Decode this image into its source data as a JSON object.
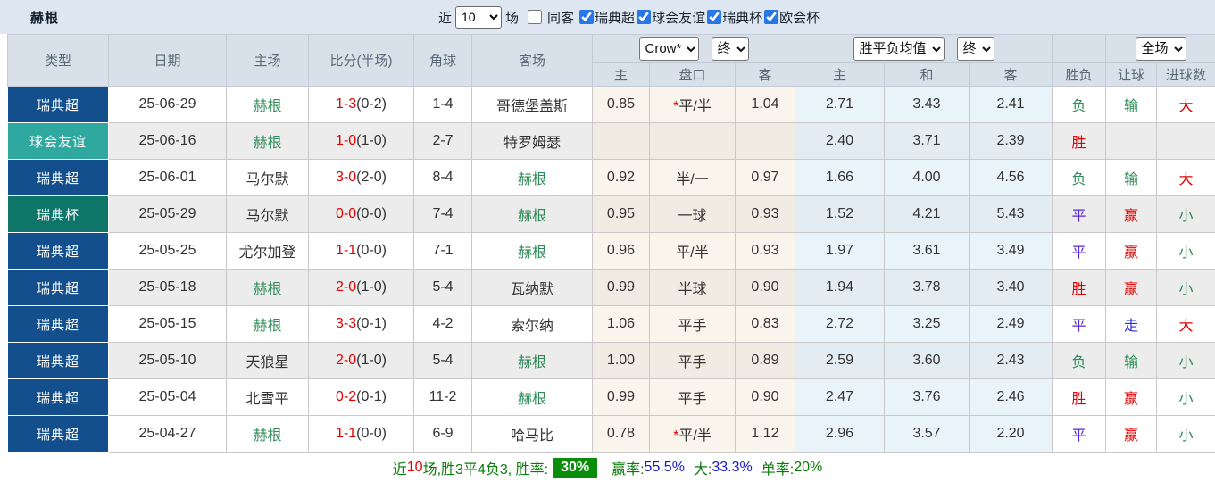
{
  "topbar": {
    "team": "赫根",
    "recent_label": "近",
    "recent_value": "10",
    "games_label": "场",
    "same_opponent": {
      "label": "同客",
      "checked": false
    },
    "filters": [
      {
        "label": "瑞典超",
        "checked": true
      },
      {
        "label": "球会友谊",
        "checked": true
      },
      {
        "label": "瑞典杯",
        "checked": true
      },
      {
        "label": "欧会杯",
        "checked": true
      }
    ]
  },
  "table": {
    "columns": [
      "类型",
      "日期",
      "主场",
      "比分(半场)",
      "角球",
      "客场"
    ],
    "odds_group": {
      "bookmaker": "Crow*",
      "time": "终",
      "subcols": [
        "主",
        "盘口",
        "客"
      ]
    },
    "avg_group": {
      "selector": "胜平负均值",
      "time": "终",
      "subcols": [
        "主",
        "和",
        "客"
      ]
    },
    "result_group": {
      "scope": "全场",
      "subcols": [
        "胜负",
        "让球",
        "进球数"
      ]
    },
    "rows": [
      {
        "type": "瑞典超",
        "type_color": "#134f8c",
        "date": "25-06-29",
        "home": "赫根",
        "home_hl": true,
        "score": "1-3",
        "half": "(0-2)",
        "corners": "1-4",
        "away": "哥德堡盖斯",
        "away_hl": false,
        "odds_home": "0.85",
        "handicap_star": true,
        "handicap": "平/半",
        "odds_away": "1.04",
        "avg_home": "2.71",
        "avg_draw": "3.43",
        "avg_away": "2.41",
        "result": "负",
        "result_color": "green",
        "let": "输",
        "let_color": "green",
        "goals": "大",
        "goals_color": "red",
        "shade": "light"
      },
      {
        "type": "球会友谊",
        "type_color": "#2fa89f",
        "date": "25-06-16",
        "home": "赫根",
        "home_hl": true,
        "score": "1-0",
        "half": "(1-0)",
        "corners": "2-7",
        "away": "特罗姆瑟",
        "away_hl": false,
        "odds_home": "",
        "handicap_star": false,
        "handicap": "",
        "odds_away": "",
        "avg_home": "2.40",
        "avg_draw": "3.71",
        "avg_away": "2.39",
        "result": "胜",
        "result_color": "red",
        "let": "",
        "let_color": "green",
        "goals": "",
        "goals_color": "green",
        "shade": "dark"
      },
      {
        "type": "瑞典超",
        "type_color": "#134f8c",
        "date": "25-06-01",
        "home": "马尔默",
        "home_hl": false,
        "score": "3-0",
        "half": "(2-0)",
        "corners": "8-4",
        "away": "赫根",
        "away_hl": true,
        "odds_home": "0.92",
        "handicap_star": false,
        "handicap": "半/一",
        "odds_away": "0.97",
        "avg_home": "1.66",
        "avg_draw": "4.00",
        "avg_away": "4.56",
        "result": "负",
        "result_color": "green",
        "let": "输",
        "let_color": "green",
        "goals": "大",
        "goals_color": "red",
        "shade": "light"
      },
      {
        "type": "瑞典杯",
        "type_color": "#0e7569",
        "date": "25-05-29",
        "home": "马尔默",
        "home_hl": false,
        "score": "0-0",
        "half": "(0-0)",
        "corners": "7-4",
        "away": "赫根",
        "away_hl": true,
        "odds_home": "0.95",
        "handicap_star": false,
        "handicap": "一球",
        "odds_away": "0.93",
        "avg_home": "1.52",
        "avg_draw": "4.21",
        "avg_away": "5.43",
        "result": "平",
        "result_color": "violet",
        "let": "赢",
        "let_color": "red",
        "goals": "小",
        "goals_color": "green",
        "shade": "dark"
      },
      {
        "type": "瑞典超",
        "type_color": "#134f8c",
        "date": "25-05-25",
        "home": "尤尔加登",
        "home_hl": false,
        "score": "1-1",
        "half": "(0-0)",
        "corners": "7-1",
        "away": "赫根",
        "away_hl": true,
        "odds_home": "0.96",
        "handicap_star": false,
        "handicap": "平/半",
        "odds_away": "0.93",
        "avg_home": "1.97",
        "avg_draw": "3.61",
        "avg_away": "3.49",
        "result": "平",
        "result_color": "violet",
        "let": "赢",
        "let_color": "red",
        "goals": "小",
        "goals_color": "green",
        "shade": "light"
      },
      {
        "type": "瑞典超",
        "type_color": "#134f8c",
        "date": "25-05-18",
        "home": "赫根",
        "home_hl": true,
        "score": "2-0",
        "half": "(1-0)",
        "corners": "5-4",
        "away": "瓦纳默",
        "away_hl": false,
        "odds_home": "0.99",
        "handicap_star": false,
        "handicap": "半球",
        "odds_away": "0.90",
        "avg_home": "1.94",
        "avg_draw": "3.78",
        "avg_away": "3.40",
        "result": "胜",
        "result_color": "red",
        "let": "赢",
        "let_color": "red",
        "goals": "小",
        "goals_color": "green",
        "shade": "dark"
      },
      {
        "type": "瑞典超",
        "type_color": "#134f8c",
        "date": "25-05-15",
        "home": "赫根",
        "home_hl": true,
        "score": "3-3",
        "half": "(0-1)",
        "corners": "4-2",
        "away": "索尔纳",
        "away_hl": false,
        "odds_home": "1.06",
        "handicap_star": false,
        "handicap": "平手",
        "odds_away": "0.83",
        "avg_home": "2.72",
        "avg_draw": "3.25",
        "avg_away": "2.49",
        "result": "平",
        "result_color": "violet",
        "let": "走",
        "let_color": "blue",
        "goals": "大",
        "goals_color": "red",
        "shade": "light"
      },
      {
        "type": "瑞典超",
        "type_color": "#134f8c",
        "date": "25-05-10",
        "home": "天狼星",
        "home_hl": false,
        "score": "2-0",
        "half": "(1-0)",
        "corners": "5-4",
        "away": "赫根",
        "away_hl": true,
        "odds_home": "1.00",
        "handicap_star": false,
        "handicap": "平手",
        "odds_away": "0.89",
        "avg_home": "2.59",
        "avg_draw": "3.60",
        "avg_away": "2.43",
        "result": "负",
        "result_color": "green",
        "let": "输",
        "let_color": "green",
        "goals": "小",
        "goals_color": "green",
        "shade": "dark"
      },
      {
        "type": "瑞典超",
        "type_color": "#134f8c",
        "date": "25-05-04",
        "home": "北雪平",
        "home_hl": false,
        "score": "0-2",
        "half": "(0-1)",
        "corners": "11-2",
        "away": "赫根",
        "away_hl": true,
        "odds_home": "0.99",
        "handicap_star": false,
        "handicap": "平手",
        "odds_away": "0.90",
        "avg_home": "2.47",
        "avg_draw": "3.76",
        "avg_away": "2.46",
        "result": "胜",
        "result_color": "red",
        "let": "赢",
        "let_color": "red",
        "goals": "小",
        "goals_color": "green",
        "shade": "light"
      },
      {
        "type": "瑞典超",
        "type_color": "#134f8c",
        "date": "25-04-27",
        "home": "赫根",
        "home_hl": true,
        "score": "1-1",
        "half": "(0-0)",
        "corners": "6-9",
        "away": "哈马比",
        "away_hl": false,
        "odds_home": "0.78",
        "handicap_star": true,
        "handicap": "平/半",
        "odds_away": "1.12",
        "avg_home": "2.96",
        "avg_draw": "3.57",
        "avg_away": "2.20",
        "result": "平",
        "result_color": "violet",
        "let": "赢",
        "let_color": "red",
        "goals": "小",
        "goals_color": "green",
        "shade": "light"
      }
    ]
  },
  "summary": {
    "prefix": "近",
    "count": "10",
    "mid": "场,胜3平4负3, 胜率:",
    "win_rate": "30%",
    "label_win": "赢率:",
    "value_win": "55.5%",
    "label_big": "大:",
    "value_big": "33.3%",
    "label_single": "单率:",
    "value_single": "20%"
  },
  "colors": {
    "league_sweden": "#134f8c",
    "friendly": "#2fa89f",
    "cup": "#0e7569",
    "win": "#e10000",
    "draw": "#5128d8",
    "lose": "#2e8b57",
    "push": "#2d2dd8",
    "accent_checkbox": "#2777e9",
    "rate_badge_bg": "#0a8d0a",
    "rate_blue": "#1818cc"
  }
}
